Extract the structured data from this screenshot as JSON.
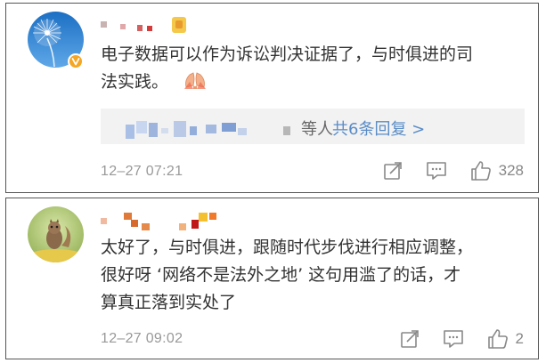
{
  "colors": {
    "text": "#333333",
    "meta": "#999999",
    "link": "#5a8cc7",
    "reply_bg": "#f2f2f2",
    "verified_badge": "#f5a623"
  },
  "comments": [
    {
      "avatar_icon": "dandelion-avatar-icon",
      "verified": true,
      "text_line1": "电子数据可以作为诉讼判决证据了，与时俱进的司",
      "text_line2": "法实践。",
      "emoji_icon": "folded-hands-icon",
      "reply_suffix": "等人",
      "reply_link": "共6条回复 >",
      "time": "12–27 07:21",
      "likes": "328"
    },
    {
      "avatar_icon": "squirrel-avatar-icon",
      "verified": false,
      "text_line1": "太好了，与时俱进，跟随时代步伐进行相应调整，",
      "text_line2": "很好呀 ‘网络不是法外之地’ 这句用滥了的话，才",
      "text_line3": "算真正落到实处了",
      "time": "12–27 09:02",
      "likes": "2"
    }
  ]
}
